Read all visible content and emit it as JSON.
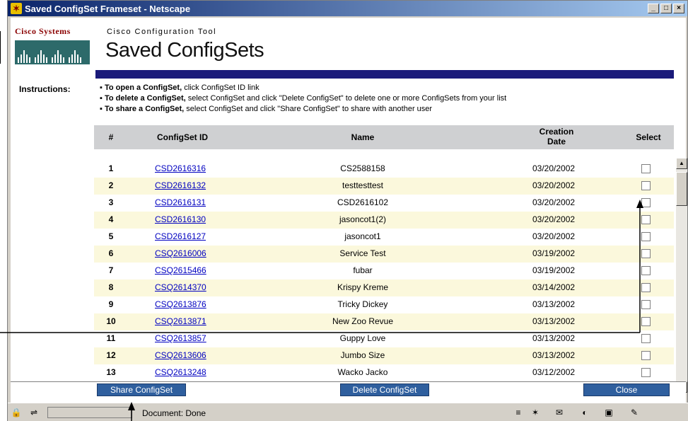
{
  "window": {
    "title": "Saved ConfigSet Frameset - Netscape",
    "buttons": [
      "_",
      "□",
      "×"
    ]
  },
  "brand": {
    "name": "Cisco Systems",
    "subtitle": "Cisco Configuration Tool",
    "page_title": "Saved ConfigSets"
  },
  "instructions": {
    "label": "Instructions:",
    "items": [
      {
        "bold": "To open a ConfigSet,",
        "text": "click ConfigSet ID link"
      },
      {
        "bold": "To delete a ConfigSet,",
        "text": "select ConfigSet and click \"Delete ConfigSet\" to delete one or more ConfigSets from your list"
      },
      {
        "bold": "To share a ConfigSet,",
        "text": "select ConfigSet and click \"Share ConfigSet\" to share with another user"
      }
    ]
  },
  "table": {
    "headers": {
      "num": "#",
      "id": "ConfigSet ID",
      "name": "Name",
      "date": "Creation Date",
      "select": "Select"
    },
    "rows": [
      {
        "num": "1",
        "id": "CSD2616316",
        "name": "CS2588158",
        "date": "03/20/2002"
      },
      {
        "num": "2",
        "id": "CSD2616132",
        "name": "testtesttest",
        "date": "03/20/2002"
      },
      {
        "num": "3",
        "id": "CSD2616131",
        "name": "CSD2616102",
        "date": "03/20/2002"
      },
      {
        "num": "4",
        "id": "CSD2616130",
        "name": "jasoncot1(2)",
        "date": "03/20/2002"
      },
      {
        "num": "5",
        "id": "CSD2616127",
        "name": "jasoncot1",
        "date": "03/20/2002"
      },
      {
        "num": "6",
        "id": "CSQ2616006",
        "name": "Service Test",
        "date": "03/19/2002"
      },
      {
        "num": "7",
        "id": "CSQ2615466",
        "name": "fubar",
        "date": "03/19/2002"
      },
      {
        "num": "8",
        "id": "CSQ2614370",
        "name": "Krispy Kreme",
        "date": "03/14/2002"
      },
      {
        "num": "9",
        "id": "CSQ2613876",
        "name": "Tricky Dickey",
        "date": "03/13/2002"
      },
      {
        "num": "10",
        "id": "CSQ2613871",
        "name": "New Zoo Revue",
        "date": "03/13/2002"
      },
      {
        "num": "11",
        "id": "CSQ2613857",
        "name": "Guppy Love",
        "date": "03/13/2002"
      },
      {
        "num": "12",
        "id": "CSQ2613606",
        "name": "Jumbo Size",
        "date": "03/13/2002"
      },
      {
        "num": "13",
        "id": "CSQ2613248",
        "name": "Wacko Jacko",
        "date": "03/12/2002"
      }
    ]
  },
  "actions": {
    "share": "Share ConfigSet",
    "delete": "Delete ConfigSet",
    "close": "Close"
  },
  "status": {
    "text": "Document: Done"
  },
  "colors": {
    "title_rule": "#1a1a7a",
    "row_alt": "#fbf8dc",
    "link": "#0000c0",
    "button": "#2f5f9e"
  }
}
